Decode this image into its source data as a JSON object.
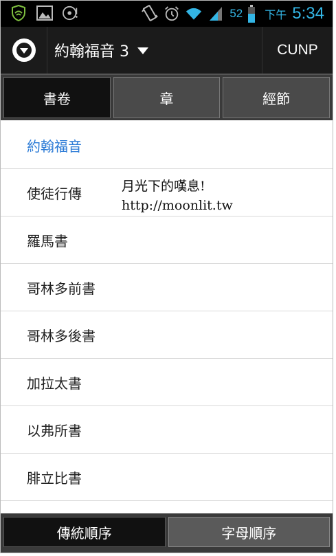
{
  "status_bar": {
    "icons_left": [
      "shield-icon",
      "image-icon",
      "media-disc-icon"
    ],
    "icons_right": [
      "vibrate-icon",
      "alarm-icon",
      "wifi-icon",
      "signal-icon",
      "battery-icon"
    ],
    "battery": "52",
    "ampm": "下午",
    "time": "5:34",
    "accent_color": "#33b5e5"
  },
  "action_bar": {
    "title": "約翰福音 3",
    "version": "CUNP"
  },
  "tabs": [
    {
      "label": "書卷",
      "active": true
    },
    {
      "label": "章",
      "active": false
    },
    {
      "label": "經節",
      "active": false
    }
  ],
  "books": [
    {
      "label": "約翰福音",
      "selected": true
    },
    {
      "label": "使徒行傳",
      "selected": false
    },
    {
      "label": "羅馬書",
      "selected": false
    },
    {
      "label": "哥林多前書",
      "selected": false
    },
    {
      "label": "哥林多後書",
      "selected": false
    },
    {
      "label": "加拉太書",
      "selected": false
    },
    {
      "label": "以弗所書",
      "selected": false
    },
    {
      "label": "腓立比書",
      "selected": false
    }
  ],
  "watermark": {
    "line1": "月光下的嘆息!",
    "line2": "http://moonlit.tw"
  },
  "bottom_buttons": [
    {
      "label": "傳統順序",
      "active": true
    },
    {
      "label": "字母順序",
      "active": false
    }
  ],
  "colors": {
    "selected_item": "#2c7bd6"
  }
}
